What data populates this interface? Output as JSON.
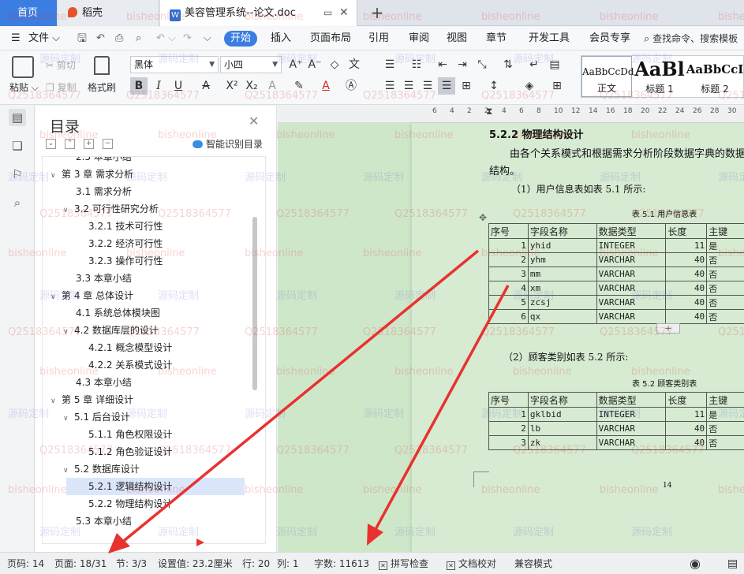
{
  "titlebar": {
    "home_tab": "首页",
    "app_tab": "稻壳",
    "doc_tab": "美容管理系统--论文.doc",
    "add_tab": "+"
  },
  "menu": {
    "file": "文件",
    "items": [
      "开始",
      "插入",
      "页面布局",
      "引用",
      "审阅",
      "视图",
      "章节",
      "开发工具",
      "会员专享"
    ],
    "active": "开始",
    "search": "查找命令、搜索模板"
  },
  "ribbon": {
    "paste": "粘贴",
    "cut": "剪切",
    "copy": "复制",
    "format_painter": "格式刷",
    "font": "黑体",
    "size": "小四",
    "styles": [
      {
        "sample": "AaBbCcDd",
        "name": "正文"
      },
      {
        "sample": "AaBl",
        "name": "标题 1"
      },
      {
        "sample": "AaBbCcI",
        "name": "标题 2"
      }
    ]
  },
  "toc": {
    "title": "目录",
    "smart": "智能识别目录",
    "items": [
      {
        "level": 2,
        "text": "2.5 本章小结",
        "caret": ""
      },
      {
        "level": 1,
        "text": "第 3 章  需求分析",
        "caret": "v"
      },
      {
        "level": 2,
        "text": "3.1 需求分析",
        "caret": ""
      },
      {
        "level": 2,
        "text": "3.2 可行性研究分析",
        "caret": "v"
      },
      {
        "level": 3,
        "text": "3.2.1 技术可行性",
        "caret": ""
      },
      {
        "level": 3,
        "text": "3.2.2 经济可行性",
        "caret": ""
      },
      {
        "level": 3,
        "text": "3.2.3 操作可行性",
        "caret": ""
      },
      {
        "level": 2,
        "text": "3.3 本章小结",
        "caret": ""
      },
      {
        "level": 1,
        "text": "第 4 章  总体设计",
        "caret": "v"
      },
      {
        "level": 2,
        "text": "4.1 系统总体模块图",
        "caret": ""
      },
      {
        "level": 2,
        "text": "4.2 数据库层的设计",
        "caret": "v"
      },
      {
        "level": 3,
        "text": "4.2.1 概念模型设计",
        "caret": ""
      },
      {
        "level": 3,
        "text": "4.2.2 关系模式设计",
        "caret": ""
      },
      {
        "level": 2,
        "text": "4.3 本章小结",
        "caret": ""
      },
      {
        "level": 1,
        "text": "第 5 章  详细设计",
        "caret": "v"
      },
      {
        "level": 2,
        "text": "5.1 后台设计",
        "caret": "v"
      },
      {
        "level": 3,
        "text": "5.1.1 角色权限设计",
        "caret": ""
      },
      {
        "level": 3,
        "text": "5.1.2 角色验证设计",
        "caret": ""
      },
      {
        "level": 2,
        "text": "5.2 数据库设计",
        "caret": "v"
      },
      {
        "level": 3,
        "text": "5.2.1 逻辑结构设计",
        "caret": "",
        "selected": true
      },
      {
        "level": 3,
        "text": "5.2.2 物理结构设计",
        "caret": ""
      },
      {
        "level": 2,
        "text": "5.3 本章小结",
        "caret": ""
      }
    ]
  },
  "ruler": [
    "6",
    "4",
    "2",
    "2",
    "4",
    "6",
    "8",
    "10",
    "12",
    "14",
    "16",
    "18",
    "20",
    "22",
    "24",
    "26",
    "28",
    "30"
  ],
  "doc": {
    "heading": "5.2.2 物理结构设计",
    "para1": "由各个关系模式和根据需求分析阶段数据字典的数据",
    "para2": "结构。",
    "t1_intro": "（1）用户信息表如表 5.1 所示:",
    "t1_caption": "表 5.1 用户信息表",
    "t2_intro": "（2）顾客类别如表 5.2 所示:",
    "t2_caption": "表 5.2 顾客类别表",
    "page_number": "14",
    "headers": [
      "序号",
      "字段名称",
      "数据类型",
      "长度",
      "主键"
    ],
    "table1": [
      [
        "1",
        "yhid",
        "INTEGER",
        "11",
        "是"
      ],
      [
        "2",
        "yhm",
        "VARCHAR",
        "40",
        "否"
      ],
      [
        "3",
        "mm",
        "VARCHAR",
        "40",
        "否"
      ],
      [
        "4",
        "xm",
        "VARCHAR",
        "40",
        "否"
      ],
      [
        "5",
        "zcsj",
        "VARCHAR",
        "40",
        "否"
      ],
      [
        "6",
        "qx",
        "VARCHAR",
        "40",
        "否"
      ]
    ],
    "table2": [
      [
        "1",
        "gklbid",
        "INTEGER",
        "11",
        "是"
      ],
      [
        "2",
        "lb",
        "VARCHAR",
        "40",
        "否"
      ],
      [
        "3",
        "zk",
        "VARCHAR",
        "40",
        "否"
      ]
    ]
  },
  "status": {
    "page_code": "页码: 14",
    "page": "页面: 18/31",
    "section": "节: 3/3",
    "setting": "设置值: 23.2厘米",
    "row": "行: 20",
    "col": "列: 1",
    "words": "字数: 11613",
    "spell": "拼写检查",
    "proof": "文档校对",
    "compat": "兼容模式"
  },
  "watermark": {
    "a": "bisheonline",
    "b": "源码定制",
    "c": "Q2518364577"
  },
  "colors": {
    "accent": "#3b7de0",
    "doc_bg": "#cfe7c9",
    "arrow": "#e8322f"
  }
}
